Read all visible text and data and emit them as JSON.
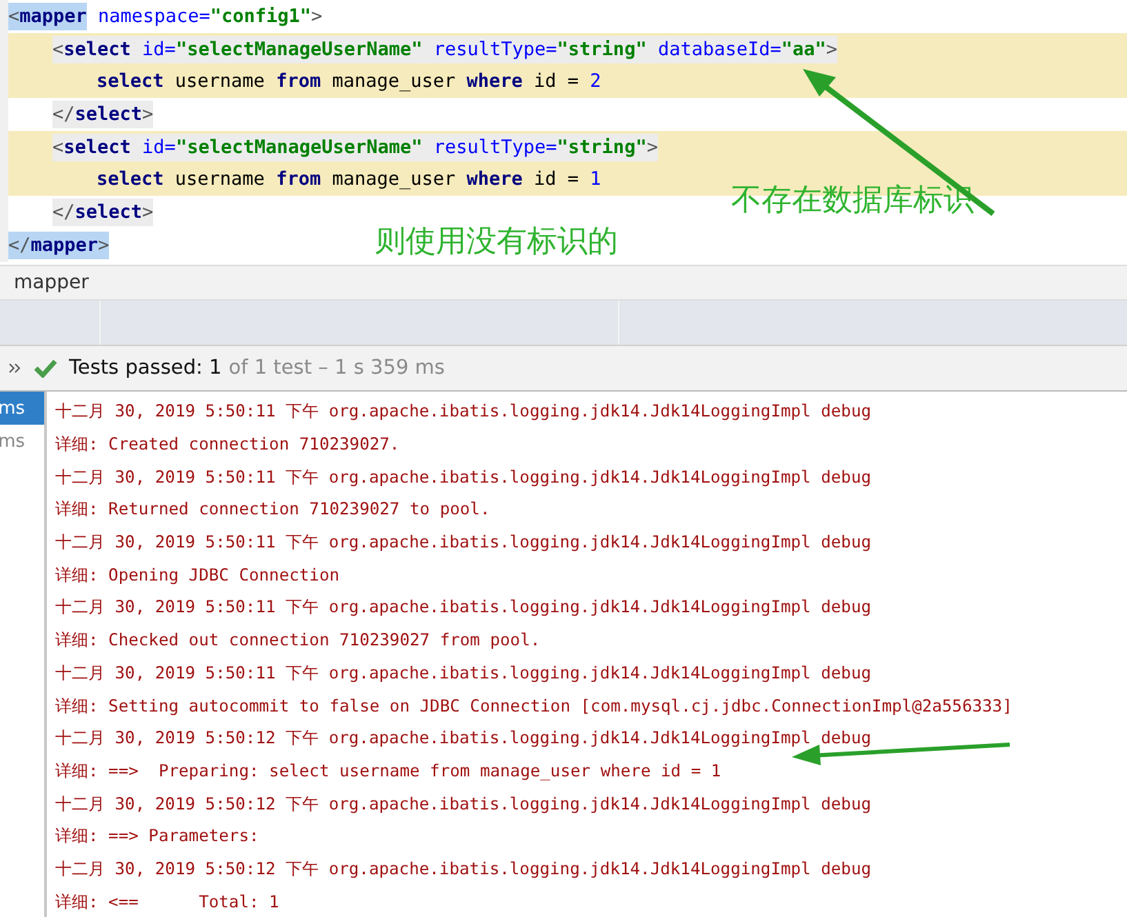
{
  "editor": {
    "lines": [
      {
        "highlighted": false,
        "boxed": false,
        "segments": [
          {
            "kind": "bracket",
            "text": "<",
            "matched": true
          },
          {
            "kind": "tag",
            "text": "mapper",
            "matched": true
          },
          {
            "kind": "attr",
            "text": " namespace="
          },
          {
            "kind": "string",
            "text": "\"config1\""
          },
          {
            "kind": "bracket",
            "text": ">"
          }
        ],
        "children": [
          {
            "highlighted": true,
            "boxed": true,
            "segments": [
              {
                "kind": "bracket",
                "text": "<"
              },
              {
                "kind": "tag",
                "text": "select"
              },
              {
                "kind": "attr",
                "text": " id="
              },
              {
                "kind": "string",
                "text": "\"selectManageUserName\""
              },
              {
                "kind": "attr",
                "text": " resultType="
              },
              {
                "kind": "string",
                "text": "\"string\""
              },
              {
                "kind": "attr",
                "text": " databaseId="
              },
              {
                "kind": "string",
                "text": "\"aa\""
              },
              {
                "kind": "bracket",
                "text": ">"
              }
            ],
            "children": [
              {
                "highlighted": true,
                "boxed": false,
                "segments": [
                  {
                    "kind": "keyword",
                    "text": "select"
                  },
                  {
                    "kind": "plain",
                    "text": " username "
                  },
                  {
                    "kind": "keyword",
                    "text": "from"
                  },
                  {
                    "kind": "plain",
                    "text": " manage_user "
                  },
                  {
                    "kind": "keyword",
                    "text": "where"
                  },
                  {
                    "kind": "plain",
                    "text": " id = "
                  },
                  {
                    "kind": "number",
                    "text": "2"
                  }
                ]
              }
            ]
          },
          {
            "highlighted": false,
            "boxed": true,
            "segments": [
              {
                "kind": "bracket",
                "text": "</"
              },
              {
                "kind": "tag",
                "text": "select"
              },
              {
                "kind": "bracket",
                "text": ">"
              }
            ]
          },
          {
            "highlighted": true,
            "boxed": true,
            "segments": [
              {
                "kind": "bracket",
                "text": "<"
              },
              {
                "kind": "tag",
                "text": "select"
              },
              {
                "kind": "attr",
                "text": " id="
              },
              {
                "kind": "string",
                "text": "\"selectManageUserName\""
              },
              {
                "kind": "attr",
                "text": " resultType="
              },
              {
                "kind": "string",
                "text": "\"string\""
              },
              {
                "kind": "bracket",
                "text": ">"
              }
            ],
            "children": [
              {
                "highlighted": true,
                "boxed": false,
                "segments": [
                  {
                    "kind": "keyword",
                    "text": "select"
                  },
                  {
                    "kind": "plain",
                    "text": " username "
                  },
                  {
                    "kind": "keyword",
                    "text": "from"
                  },
                  {
                    "kind": "plain",
                    "text": " manage_user "
                  },
                  {
                    "kind": "keyword",
                    "text": "where"
                  },
                  {
                    "kind": "plain",
                    "text": " id = "
                  },
                  {
                    "kind": "number",
                    "text": "1"
                  }
                ]
              }
            ]
          },
          {
            "highlighted": false,
            "boxed": true,
            "segments": [
              {
                "kind": "bracket",
                "text": "</"
              },
              {
                "kind": "tag",
                "text": "select"
              },
              {
                "kind": "bracket",
                "text": ">"
              }
            ]
          }
        ]
      },
      {
        "highlighted": false,
        "boxed": false,
        "segments": [
          {
            "kind": "bracket",
            "text": "</",
            "matched": true
          },
          {
            "kind": "tag",
            "text": "mapper",
            "matched": true
          },
          {
            "kind": "bracket",
            "text": ">",
            "matched": true
          }
        ]
      }
    ],
    "notes": [
      "不存在数据库标识",
      "则使用没有标识的"
    ]
  },
  "breadcrumb": "mapper",
  "test_status": {
    "label": "Tests passed: 1",
    "detail": "of 1 test – 1 s 359 ms"
  },
  "test_list": [
    {
      "label": "ms",
      "selected": true
    },
    {
      "label": "ms",
      "selected": false
    }
  ],
  "log": [
    {
      "text": "十二月 30, 2019 5:50:11 下午 org.apache.ibatis.logging.jdk14.Jdk14LoggingImpl debug"
    },
    {
      "text": "详细: Created connection 710239027."
    },
    {
      "text": "十二月 30, 2019 5:50:11 下午 org.apache.ibatis.logging.jdk14.Jdk14LoggingImpl debug"
    },
    {
      "text": "详细: Returned connection 710239027 to pool."
    },
    {
      "text": "十二月 30, 2019 5:50:11 下午 org.apache.ibatis.logging.jdk14.Jdk14LoggingImpl debug"
    },
    {
      "text": "详细: Opening JDBC Connection"
    },
    {
      "text": "十二月 30, 2019 5:50:11 下午 org.apache.ibatis.logging.jdk14.Jdk14LoggingImpl debug"
    },
    {
      "text": "详细: Checked out connection 710239027 from pool."
    },
    {
      "text": "十二月 30, 2019 5:50:11 下午 org.apache.ibatis.logging.jdk14.Jdk14LoggingImpl debug"
    },
    {
      "text": "详细: Setting autocommit to false on JDBC Connection [com.mysql.cj.jdbc.ConnectionImpl@2a556333]"
    },
    {
      "text": "十二月 30, 2019 5:50:12 下午 org.apache.ibatis.logging.jdk14.Jdk14LoggingImpl debug"
    },
    {
      "text": "详细: ==>  Preparing: select username from manage_user where id = 1"
    },
    {
      "text": "十二月 30, 2019 5:50:12 下午 org.apache.ibatis.logging.jdk14.Jdk14LoggingImpl debug"
    },
    {
      "text": "详细: ==> Parameters:"
    },
    {
      "text": "十二月 30, 2019 5:50:12 下午 org.apache.ibatis.logging.jdk14.Jdk14LoggingImpl debug"
    },
    {
      "text": "详细: <==      Total: 1"
    }
  ]
}
